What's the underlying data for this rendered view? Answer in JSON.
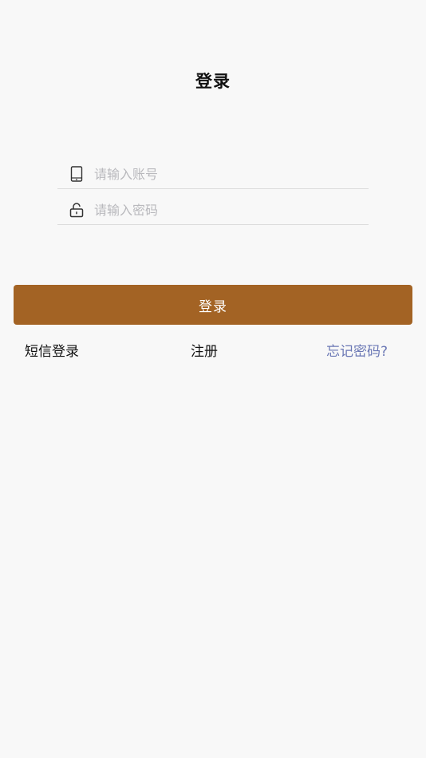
{
  "header": {
    "title": "登录"
  },
  "form": {
    "account": {
      "icon": "phone-icon",
      "value": "",
      "placeholder": "请输入账号"
    },
    "password": {
      "icon": "unlock-icon",
      "value": "",
      "placeholder": "请输入密码"
    },
    "login_label": "登录"
  },
  "links": {
    "sms_login": "短信登录",
    "register": "注册",
    "forgot_password": "忘记密码?"
  },
  "colors": {
    "background": "#f8f8f8",
    "button": "#a36324",
    "forgot_link": "#6b78b5",
    "placeholder": "#b9b9bd"
  }
}
